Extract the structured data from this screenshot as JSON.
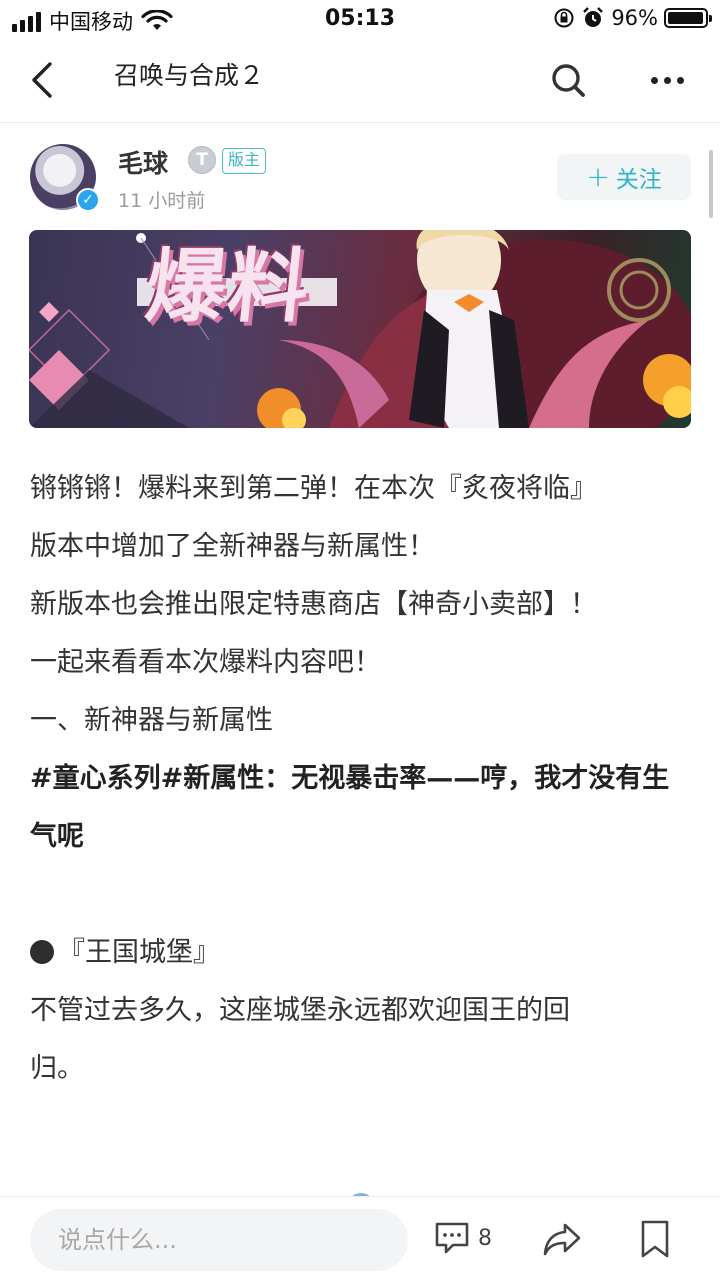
{
  "status_bar": {
    "carrier": "中国移动",
    "time": "05:13",
    "battery_percent": "96%",
    "battery_level": 0.96,
    "icons": [
      "signal-icon",
      "wifi-icon",
      "rotation-lock-icon",
      "alarm-icon",
      "battery-icon"
    ]
  },
  "nav": {
    "title": "召唤与合成２",
    "icons": [
      "back-arrow-icon",
      "search-icon",
      "more-icon"
    ]
  },
  "author": {
    "name": "毛球",
    "level_badge": "T",
    "role_badge": "版主",
    "time": "11 小时前",
    "follow_label": "关注",
    "follow_icon": "plus-icon"
  },
  "banner": {
    "title": "爆料"
  },
  "article": {
    "lines": [
      "锵锵锵！爆料来到第二弹！在本次『炙夜将临』",
      "版本中增加了全新神器与新属性！",
      "新版本也会推出限定特惠商店【神奇小卖部】！",
      "一起来看看本次爆料内容吧！",
      "一、新神器与新属性"
    ],
    "bold_heading": "#童心系列#新属性：无视暴击率——哼，我才没有生气呢",
    "item_title": "『王国城堡』",
    "item_desc_line1": "不管过去多久，这座城堡永远都欢迎国王的回",
    "item_desc_line2": "归。"
  },
  "bottom_bar": {
    "comment_placeholder": "说点什么...",
    "comment_count": "8",
    "icons": [
      "comment-icon",
      "share-icon",
      "bookmark-icon"
    ]
  },
  "colors": {
    "accent": "#2fb4c8",
    "text": "#333333",
    "muted": "#9a9a9a",
    "verified": "#2aa4ef"
  }
}
